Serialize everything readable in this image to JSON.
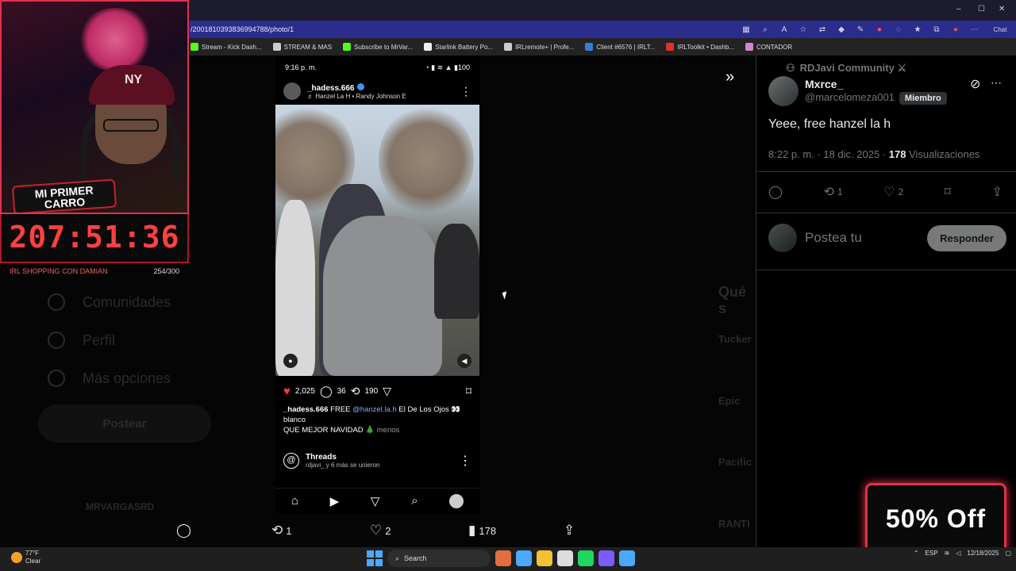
{
  "browser": {
    "url": "/2001810393836994788/photo/1",
    "window_controls": [
      "–",
      "☐",
      "✕"
    ],
    "toolbar_icons": [
      "grid-icon",
      "zoom-icon",
      "read-aloud-icon",
      "star-icon",
      "translate-icon",
      "extension-icon",
      "extension-icon",
      "extension-icon",
      "extension-icon",
      "favorites-icon",
      "collections-icon",
      "profile-icon",
      "more-icon"
    ],
    "copilot_label": "Chat",
    "bookmarks": [
      {
        "label": "Stream - Kick Dash...",
        "color": "#53fc18"
      },
      {
        "label": "STREAM & MAS",
        "color": "#cccccc"
      },
      {
        "label": "Subscribe to MrVar...",
        "color": "#53fc18"
      },
      {
        "label": "Starlink Battery Po...",
        "color": "#eeeeee"
      },
      {
        "label": "IRLremote+ | Profe...",
        "color": "#cccccc"
      },
      {
        "label": "Client #6576 | IRLT...",
        "color": "#3a7bd5"
      },
      {
        "label": "IRLToolkit • Dashb...",
        "color": "#e03030"
      },
      {
        "label": "CONTADOR",
        "color": "#cc88cc"
      }
    ]
  },
  "background_x": {
    "menu": [
      "Comunidades",
      "Perfil",
      "Más opciones"
    ],
    "post_button": "Postear",
    "account_name": "MRVARGASRD",
    "section_heading": "Qué s",
    "trend_items": [
      "Tucker",
      "Epic",
      "Pacific",
      "RANTI"
    ]
  },
  "stream_overlay": {
    "cap_logo": "NY",
    "badge_line1": "MI PRIMER",
    "badge_line2": "CARRO",
    "timer": "207:51:36",
    "goal_label": "IRL SHOPPING CON DAMIAN",
    "goal_count": "254/300"
  },
  "instagram": {
    "status_time": "9:16 p. m.",
    "status_icons": "◔ ▮ ≋ ▲ ▮100",
    "username": "_hadess.666",
    "song": "♬ Hanzel La H • Randy Johnson E",
    "likes": "2,025",
    "comments": "36",
    "reposts": "190",
    "caption_user": "_hadess.666",
    "caption_free": "FREE",
    "caption_mention": "@hanzel.la.h",
    "caption_rest": "El De Los Ojos 👀 blanco",
    "caption_line2": "QUE MEJOR NAVIDAD 🎄",
    "caption_less": "menos",
    "threads_title": "Threads",
    "threads_sub": "rdjavi_ y 6 más se unieron"
  },
  "x_bottom_bar": {
    "reposts": "1",
    "likes": "2",
    "views": "178"
  },
  "tweet": {
    "community": "RDJavi Community ⚔",
    "author_name": "Mxrce_",
    "author_handle": "@marcelomeza001",
    "member_badge": "Miembro",
    "text": "Yeee, free hanzel la h",
    "time": "8:22 p. m. · 18 dic. 2025 · ",
    "views_count": "178",
    "views_label": " Visualizaciones",
    "reposts": "1",
    "likes": "2",
    "reply_placeholder": "Postea tu",
    "reply_button": "Responder"
  },
  "promo": {
    "text": "50% Off"
  },
  "taskbar": {
    "temp": "77°F",
    "condition": "Clear",
    "search_label": "Search",
    "lang": "ESP",
    "date": "12/18/2025",
    "apps": [
      "#e07040",
      "#4aa8ff",
      "#f2c230",
      "#dddddd",
      "#1ed760",
      "#7a5cff",
      "#4aa8ff"
    ]
  }
}
